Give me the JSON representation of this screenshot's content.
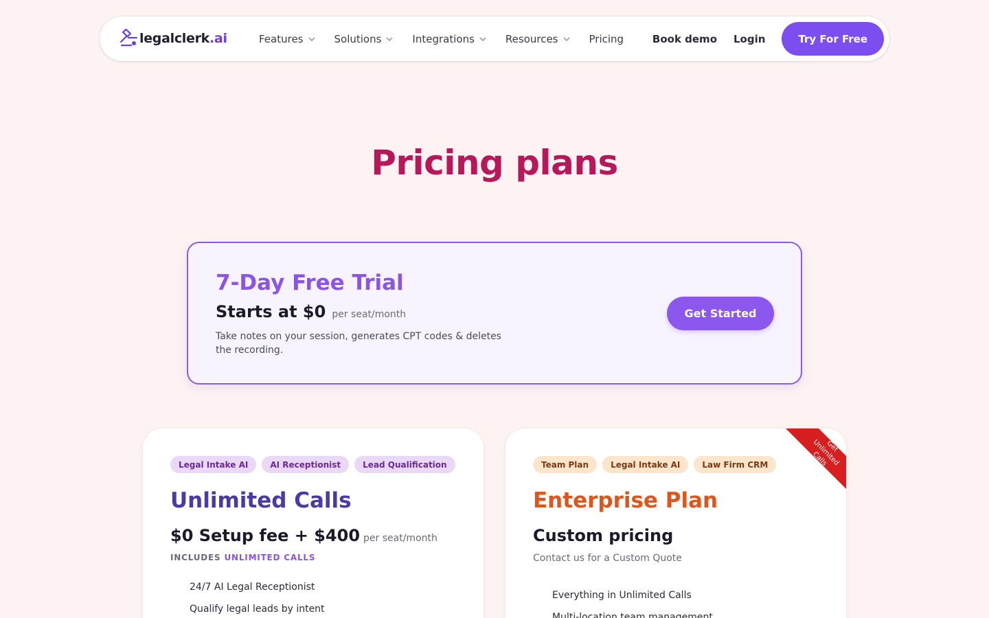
{
  "nav": {
    "logo_main": "legalclerk",
    "logo_suffix": ".ai",
    "menu": [
      {
        "label": "Features",
        "has_dropdown": true
      },
      {
        "label": "Solutions",
        "has_dropdown": true
      },
      {
        "label": "Integrations",
        "has_dropdown": true
      },
      {
        "label": "Resources",
        "has_dropdown": true
      },
      {
        "label": "Pricing",
        "has_dropdown": false
      }
    ],
    "book_demo": "Book demo",
    "login": "Login",
    "try_free": "Try For Free"
  },
  "page_title": "Pricing plans",
  "trial": {
    "title": "7-Day Free Trial",
    "price": "Starts at $0",
    "price_unit": "per seat/month",
    "description": "Take notes on your session, generates CPT codes & deletes the recording.",
    "cta": "Get Started"
  },
  "plans": [
    {
      "tags": [
        "Legal Intake AI",
        "AI Receptionist",
        "Lead Qualification"
      ],
      "title": "Unlimited Calls",
      "price": "$0 Setup fee + $400",
      "price_unit": "per seat/month",
      "includes_prefix": "INCLUDES",
      "includes_highlight": "UNLIMITED CALLS",
      "features": [
        "24/7 AI Legal Receptionist",
        "Qualify legal leads by intent"
      ]
    },
    {
      "tags": [
        "Team Plan",
        "Legal Intake AI",
        "Law Firm CRM"
      ],
      "title": "Enterprise Plan",
      "price": "Custom pricing",
      "subtitle": "Contact us for a Custom Quote",
      "ribbon": "Get Unlimited Calls",
      "features": [
        "Everything in Unlimited Calls",
        "Multi-location team management"
      ]
    }
  ],
  "colors": {
    "background": "#fdf3f3",
    "accent_purple": "#7c4ef0",
    "title_magenta": "#b8185a",
    "enterprise_orange": "#e0561a",
    "ribbon_red": "#d81f1f"
  },
  "icons": {
    "logo": "gavel-icon",
    "dropdown": "chevron-down-icon"
  }
}
